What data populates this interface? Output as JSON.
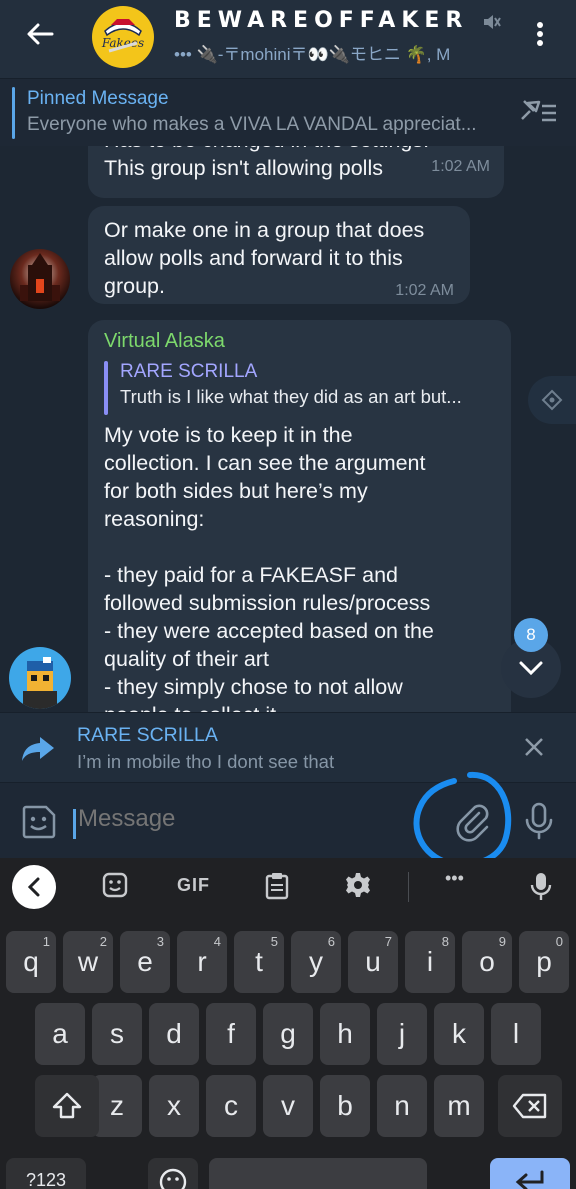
{
  "header": {
    "title": "BEWAREOFFAKER",
    "subtitle": "••• 🔌-〒mohini〒👀🔌モヒニ 🌴, M",
    "avatar_text": "Fakees"
  },
  "pinned": {
    "title": "Pinned Message",
    "text": "Everyone who makes a VIVA LA VANDAL appreciat..."
  },
  "messages": [
    {
      "text": "Has to be changed in the settings.\nThis group isn't allowing polls",
      "time": "1:02 AM"
    },
    {
      "text": "Or make one in a group that does\nallow polls and forward it to this\ngroup.",
      "time": "1:02 AM"
    },
    {
      "sender": "Virtual Alaska",
      "reply_name": "RARE SCRILLA",
      "reply_text": "Truth is I like what they did as an art but...",
      "text": "My vote is to keep it in the\ncollection.  I can see the argument\nfor both sides but here’s my\nreasoning:\n\n- they paid for a FAKEASF and\nfollowed submission rules/process\n- they were accepted based on the\nquality of their art\n- they simply chose to not allow\npeople to collect it"
    }
  ],
  "unread_count": "8",
  "reply_bar": {
    "name": "RARE SCRILLA",
    "text": "I’m in mobile tho I dont see that"
  },
  "input": {
    "placeholder": "Message"
  },
  "keyboard_toolbar": {
    "gif_label": "GIF",
    "more": "•••"
  },
  "keyboard": {
    "row1": [
      {
        "k": "q",
        "n": "1"
      },
      {
        "k": "w",
        "n": "2"
      },
      {
        "k": "e",
        "n": "3"
      },
      {
        "k": "r",
        "n": "4"
      },
      {
        "k": "t",
        "n": "5"
      },
      {
        "k": "y",
        "n": "6"
      },
      {
        "k": "u",
        "n": "7"
      },
      {
        "k": "i",
        "n": "8"
      },
      {
        "k": "o",
        "n": "9"
      },
      {
        "k": "p",
        "n": "0"
      }
    ],
    "row2": [
      "a",
      "s",
      "d",
      "f",
      "g",
      "h",
      "j",
      "k",
      "l"
    ],
    "row3": [
      "z",
      "x",
      "c",
      "v",
      "b",
      "n",
      "m"
    ],
    "symbols_label": "?123"
  },
  "colors": {
    "accent": "#5aa6e8",
    "sender_green": "#7dd86c",
    "reply_purple": "#a3a6ff",
    "annotation_blue": "#1a8cf0"
  }
}
